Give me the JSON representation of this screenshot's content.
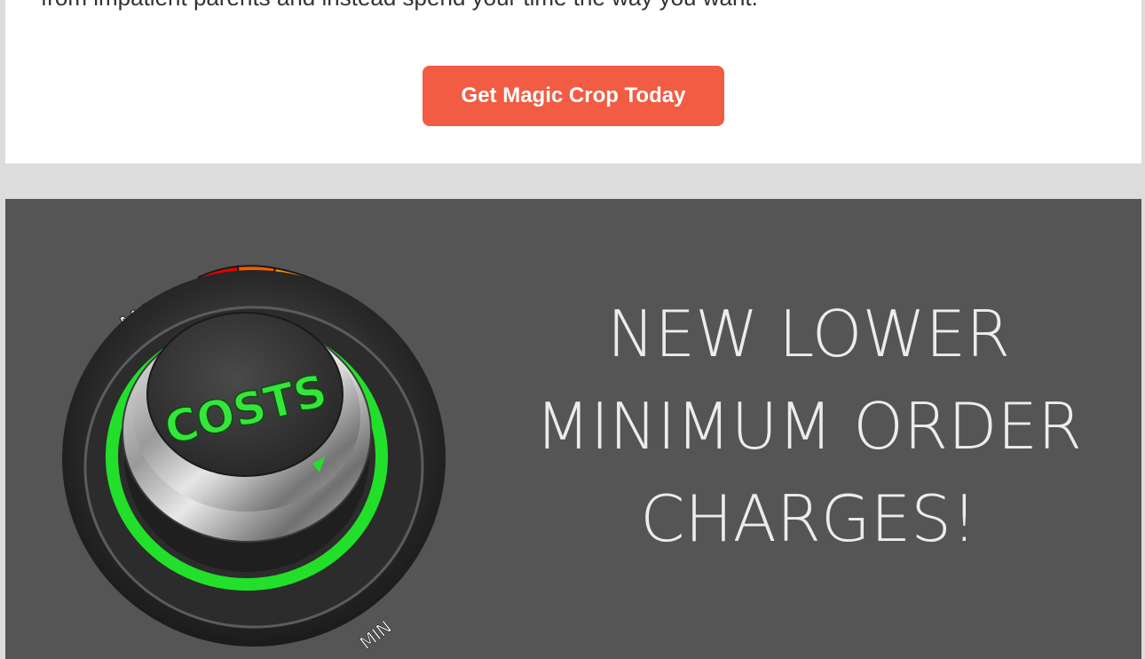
{
  "intro": {
    "text": "from impatient parents and instead spend your time the way you want."
  },
  "cta": {
    "label": "Get Magic Crop Today"
  },
  "banner": {
    "knob": {
      "label": "COSTS",
      "max_label": "MAX",
      "min_label": "MIN"
    },
    "headline": {
      "line1": "NEW LOWER",
      "line2": "MINIMUM ORDER",
      "line3": "CHARGES!"
    }
  },
  "colors": {
    "page_background": "#dcdcdc",
    "card_background": "#ffffff",
    "cta_background": "#f25c42",
    "banner_background": "#555555",
    "headline_text": "#ececec",
    "knob_glow": "#22e02a"
  }
}
